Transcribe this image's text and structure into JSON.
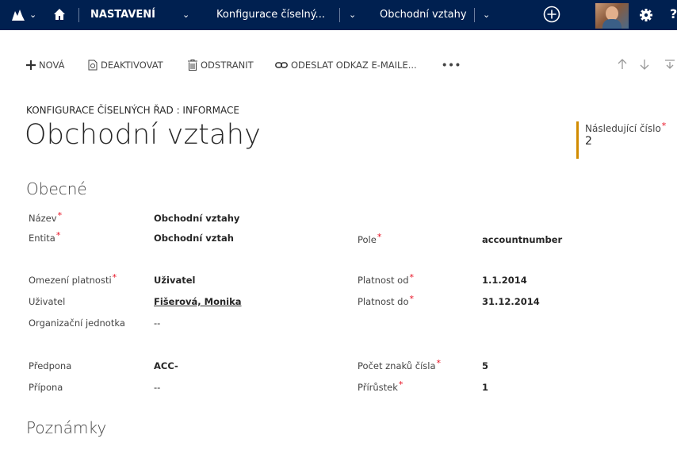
{
  "nav": {
    "section_label": "NASTAVENÍ",
    "crumb_1": "Konfigurace číselný...",
    "crumb_2": "Obchodní vztahy",
    "bg_color": "#002050"
  },
  "commands": {
    "new": "NOVÁ",
    "deactivate": "DEAKTIVOVAT",
    "delete": "ODSTRANIT",
    "email_link": "ODESLAT ODKAZ E-MAILE...",
    "more": "•••"
  },
  "form": {
    "breadcrumb": "KONFIGURACE ČÍSELNÝCH ŘAD : INFORMACE",
    "title": "Obchodní vztahy",
    "header_field": {
      "label": "Následující číslo",
      "value": "2"
    }
  },
  "sections": {
    "general": "Obecné",
    "notes": "Poznámky"
  },
  "fields": {
    "name": {
      "label": "Název",
      "value": "Obchodní vztahy"
    },
    "entity": {
      "label": "Entita",
      "value": "Obchodní vztah"
    },
    "field": {
      "label": "Pole",
      "value": "accountnumber"
    },
    "validity": {
      "label": "Omezení platnosti",
      "value": "Uživatel"
    },
    "valid_from": {
      "label": "Platnost od",
      "value": "1.1.2014"
    },
    "user": {
      "label": "Uživatel",
      "value": "Fišerová, Monika"
    },
    "valid_to": {
      "label": "Platnost do",
      "value": "31.12.2014"
    },
    "org_unit": {
      "label": "Organizační jednotka",
      "value": "--"
    },
    "prefix": {
      "label": "Předpona",
      "value": "ACC-"
    },
    "digits": {
      "label": "Počet znaků čísla",
      "value": "5"
    },
    "suffix": {
      "label": "Přípona",
      "value": "--"
    },
    "increment": {
      "label": "Přírůstek",
      "value": "1"
    }
  },
  "colors": {
    "accent_bar": "#d18b00",
    "required": "#e81123"
  }
}
